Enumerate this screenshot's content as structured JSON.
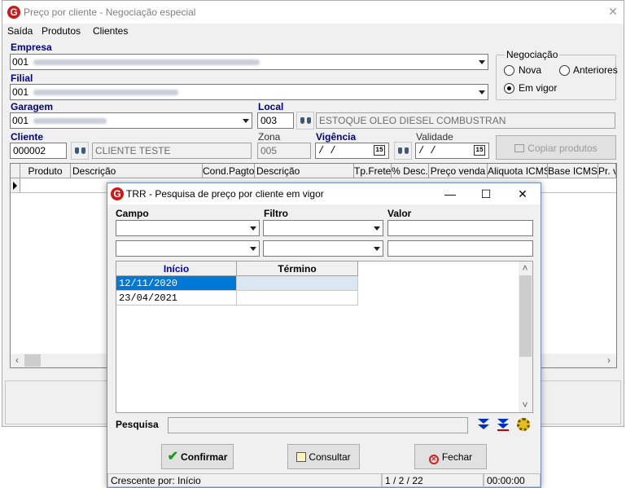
{
  "main_window": {
    "title": "Preço por cliente - Negociação especial",
    "menu": [
      "Saída",
      "Produtos",
      "Clientes"
    ],
    "empresa": {
      "label": "Empresa",
      "code": "001"
    },
    "filial": {
      "label": "Filial",
      "code": "001"
    },
    "garagem": {
      "label": "Garagem",
      "code": "001"
    },
    "local": {
      "label": "Local",
      "code": "003",
      "description": "ESTOQUE OLEO DIESEL COMBUSTRAN"
    },
    "negociacao": {
      "title": "Negociação",
      "options": [
        "Nova",
        "Anteriores",
        "Em vigor"
      ],
      "selected": "Em vigor"
    },
    "cliente": {
      "label": "Cliente",
      "code": "000002",
      "name": "CLIENTE TESTE"
    },
    "zona": {
      "label": "Zona",
      "value": "005"
    },
    "vigencia": {
      "label": "Vigência",
      "value": " / /"
    },
    "validade": {
      "label": "Validade",
      "value": " / /"
    },
    "copy_button": "Copiar produtos",
    "calendar_glyph": "15",
    "grid_columns": [
      "Produto",
      "Descrição",
      "Cond.Pagto",
      "Descrição",
      "Tp.Frete",
      "% Desc.",
      "Preço venda",
      "Aliquota ICMS",
      "Base ICMS",
      "Pr. vig"
    ]
  },
  "dialog": {
    "title": "TRR - Pesquisa de preço por cliente em vigor",
    "campo_label": "Campo",
    "filtro_label": "Filtro",
    "valor_label": "Valor",
    "columns": [
      "Início",
      "Término"
    ],
    "rows": [
      {
        "inicio": "12/11/2020",
        "termino": ""
      },
      {
        "inicio": "23/04/2021",
        "termino": ""
      }
    ],
    "pesquisa_label": "Pesquisa",
    "buttons": {
      "confirm": "Confirmar",
      "consult": "Consultar",
      "close": "Fechar"
    },
    "status": {
      "sort": "Crescente por: Início",
      "position": "1 / 2 / 22",
      "time": "00:00:00"
    }
  },
  "colors": {
    "accent": "#0078d7",
    "label_blue": "#000080",
    "logo_red": "#d01818"
  }
}
